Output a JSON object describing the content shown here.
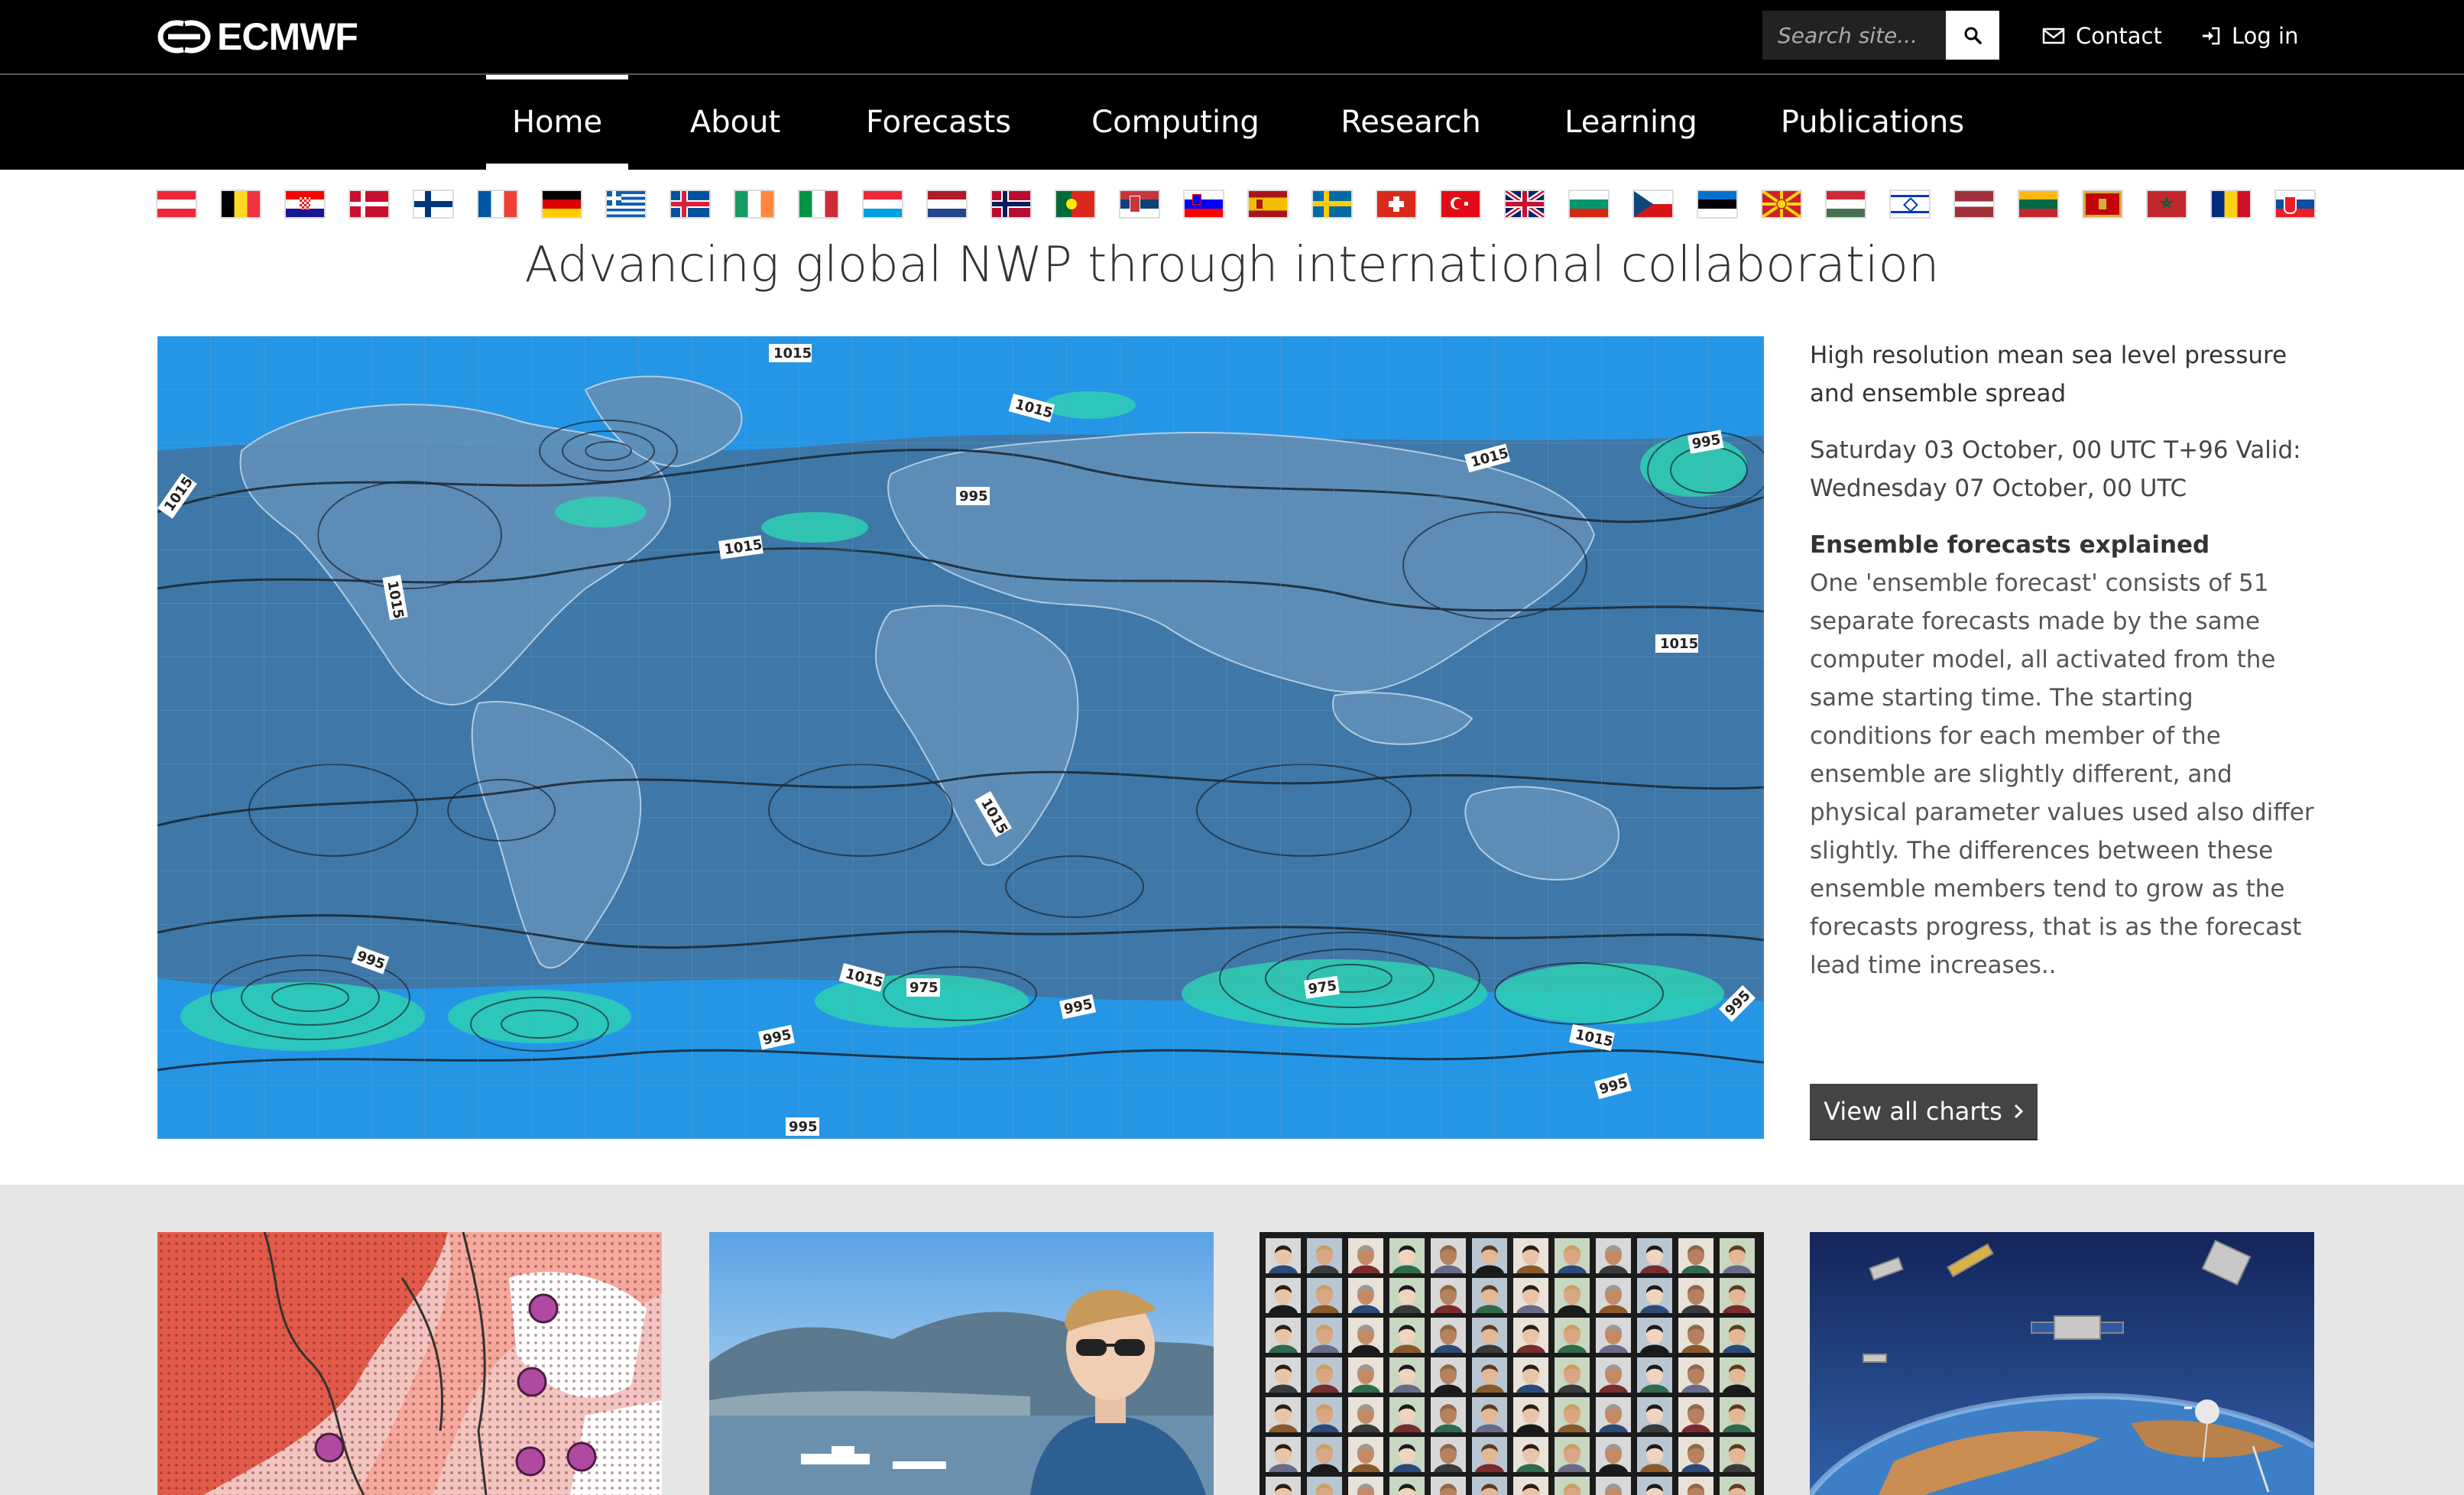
{
  "header": {
    "logo_text": "ECMWF",
    "search_placeholder": "Search site...",
    "contact_label": "Contact",
    "login_label": "Log in"
  },
  "nav": {
    "items": [
      {
        "label": "Home",
        "active": true
      },
      {
        "label": "About"
      },
      {
        "label": "Forecasts"
      },
      {
        "label": "Computing"
      },
      {
        "label": "Research"
      },
      {
        "label": "Learning"
      },
      {
        "label": "Publications"
      }
    ]
  },
  "flags": [
    "austria",
    "belgium",
    "croatia",
    "denmark",
    "finland",
    "france",
    "germany",
    "greece",
    "iceland",
    "ireland",
    "italy",
    "luxembourg",
    "netherlands",
    "norway",
    "portugal",
    "serbia",
    "slovenia",
    "spain",
    "sweden",
    "switzerland",
    "turkey",
    "united-kingdom",
    "bulgaria",
    "czech-republic",
    "estonia",
    "north-macedonia",
    "hungary",
    "israel",
    "latvia",
    "lithuania",
    "montenegro",
    "morocco",
    "romania",
    "slovakia"
  ],
  "hero": {
    "headline": "Advancing global NWP through international collaboration",
    "chart_title": "High resolution mean sea level pressure and ensemble spread",
    "chart_date": "Saturday 03 October, 00 UTC T+96 Valid: Wednesday 07 October, 00 UTC",
    "explainer_title": "Ensemble forecasts explained",
    "explainer_body": "One 'ensemble forecast' consists of 51 separate forecasts made by the same computer model, all activated from the same starting time. The starting conditions for each member of the ensemble are slightly different, and physical parameter values used also differ slightly. The differences between these ensemble members tend to grow as the forecasts progress, that is as the forecast lead time increases..",
    "view_all_label": "View all charts",
    "isobar_labels": [
      "1015",
      "1015",
      "1015",
      "1015",
      "1015",
      "995",
      "1015",
      "995",
      "1015",
      "1015",
      "995",
      "1015",
      "995",
      "975",
      "995",
      "975",
      "1015",
      "995",
      "995",
      "995"
    ]
  },
  "cards": [
    "heat-risk-map",
    "researcher-portrait",
    "staff-photo-grid",
    "satellite-observing-system"
  ],
  "colors": {
    "topbar": "#000000",
    "ocean": "#1f8ee0",
    "land": "#4a7aa0",
    "spread": "#2ed0b4",
    "button": "#444444"
  }
}
